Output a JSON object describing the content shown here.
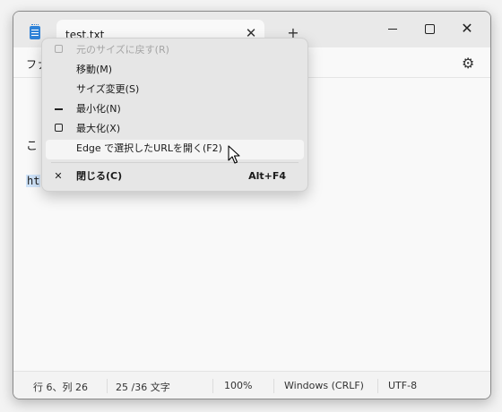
{
  "window": {
    "tab_title": "test.txt",
    "tab_close_glyph": "✕",
    "new_tab_glyph": "+",
    "close_glyph": "✕"
  },
  "menubar": {
    "file_label": "ファ",
    "settings_icon": "gear-icon",
    "settings_glyph": "⚙"
  },
  "editor": {
    "line1_partial": "こ",
    "line2_selected": "ht"
  },
  "context_menu": {
    "items": [
      {
        "label": "元のサイズに戻す(R)",
        "icon": "restore-icon",
        "disabled": true
      },
      {
        "label": "移動(M)"
      },
      {
        "label": "サイズ変更(S)"
      },
      {
        "label": "最小化(N)",
        "icon": "minimize-icon"
      },
      {
        "label": "最大化(X)",
        "icon": "maximize-icon"
      },
      {
        "label": "Edge で選択したURLを開く(F2)",
        "highlighted": true
      },
      {
        "label": "閉じる(C)",
        "icon": "close-icon",
        "icon_glyph": "✕",
        "shortcut": "Alt+F4"
      }
    ]
  },
  "status": {
    "position": "行 6、列 26",
    "chars": "25 /36 文字",
    "zoom": "100%",
    "line_ending": "Windows (CRLF)",
    "encoding": "UTF-8"
  }
}
